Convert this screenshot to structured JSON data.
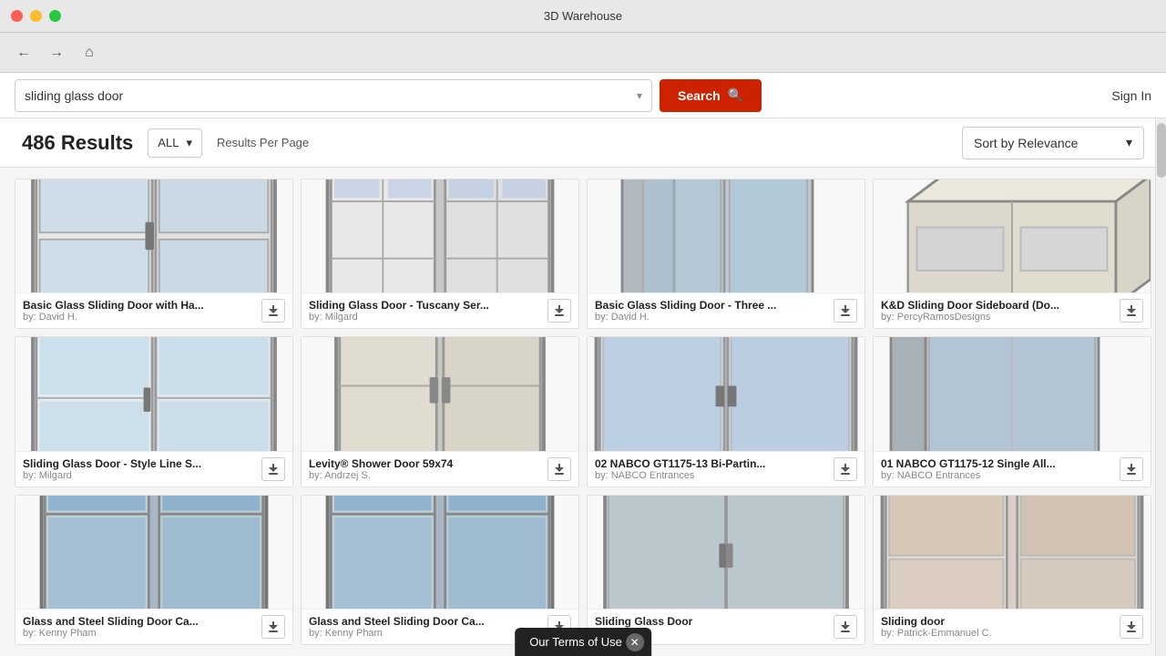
{
  "app": {
    "title": "3D Warehouse"
  },
  "nav": {
    "back_label": "←",
    "forward_label": "→",
    "home_label": "⌂"
  },
  "search": {
    "query": "sliding glass door",
    "placeholder": "Search",
    "button_label": "Search",
    "sign_in_label": "Sign In",
    "dropdown_icon": "▾"
  },
  "results": {
    "count": "486 Results",
    "filter_label": "ALL",
    "results_per_page_label": "Results Per Page",
    "sort_label": "Sort by Relevance"
  },
  "items": [
    {
      "title": "Basic Glass Sliding Door with Ha...",
      "author": "by: David H.",
      "color": "#d0d0d0"
    },
    {
      "title": "Sliding Glass Door - Tuscany Ser...",
      "author": "by: Milgard",
      "color": "#c8c8c8"
    },
    {
      "title": "Basic Glass Sliding Door - Three ...",
      "author": "by: David H.",
      "color": "#b8b8c8"
    },
    {
      "title": "K&D Sliding Door Sideboard (Do...",
      "author": "by: PercyRamosDesigns",
      "color": "#e0e0d0"
    },
    {
      "title": "Sliding Glass Door - Style Line S...",
      "author": "by: Milgard",
      "color": "#d0d8e0"
    },
    {
      "title": "Levity® Shower Door 59x74",
      "author": "by: Andrzej S.",
      "color": "#c0c8c0"
    },
    {
      "title": "02 NABCO GT1175-13 Bi-Partin...",
      "author": "by: NABCO Entrances",
      "color": "#b8c8d8"
    },
    {
      "title": "01 NABCO GT1175-12 Single All...",
      "author": "by: NABCO Entrances",
      "color": "#c0c8d0"
    },
    {
      "title": "Glass and Steel Sliding Door Ca...",
      "author": "by: Kenny Pham",
      "color": "#a8b8c8"
    },
    {
      "title": "Glass and Steel Sliding Door Ca...",
      "author": "by: Kenny Pham",
      "color": "#a8b8c8"
    },
    {
      "title": "Sliding Glass Door",
      "author": "by:",
      "color": "#c0c8c8"
    },
    {
      "title": "Sliding door",
      "author": "by: Patrick-Emmanuel C.",
      "color": "#d8d0c8"
    }
  ],
  "terms": {
    "label": "Our Terms of Use"
  }
}
